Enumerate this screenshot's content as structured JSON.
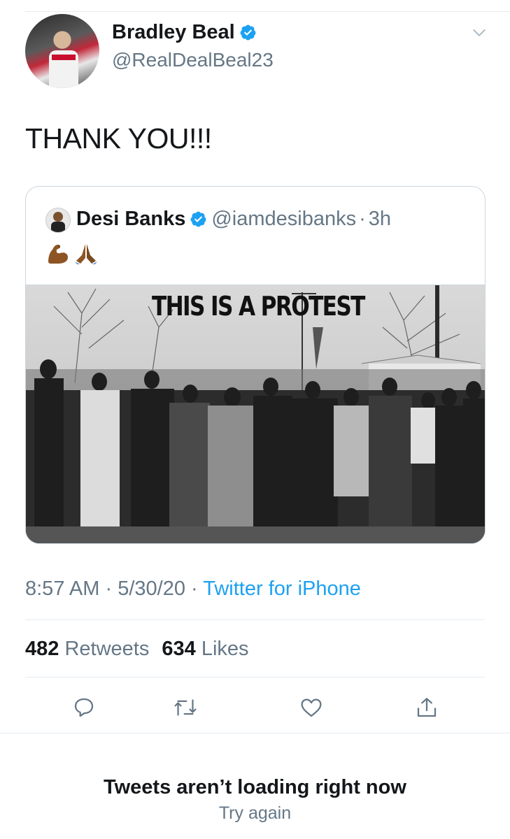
{
  "tweet": {
    "author": {
      "display_name": "Bradley Beal",
      "handle": "@RealDealBeal23",
      "verified": true
    },
    "text": "THANK YOU!!!",
    "quoted": {
      "author": {
        "display_name": "Desi Banks",
        "handle": "@iamdesibanks",
        "verified": true
      },
      "separator": "·",
      "age": "3h",
      "emojis": [
        "flexed-biceps",
        "folded-hands"
      ],
      "image": {
        "caption": "THIS IS A PROTEST",
        "style": "black-and-white-photo"
      }
    },
    "time": "8:57 AM",
    "date": "5/30/20",
    "meta_separator": "·",
    "source": "Twitter for iPhone",
    "retweets_count": "482",
    "retweets_label": "Retweets",
    "likes_count": "634",
    "likes_label": "Likes"
  },
  "actions": [
    "reply-icon",
    "retweet-icon",
    "like-icon",
    "share-icon"
  ],
  "error": {
    "title": "Tweets aren’t loading right now",
    "retry": "Try again"
  },
  "colors": {
    "accent": "#1da1f2",
    "secondary_text": "#657786",
    "border": "#ccd6dd"
  }
}
